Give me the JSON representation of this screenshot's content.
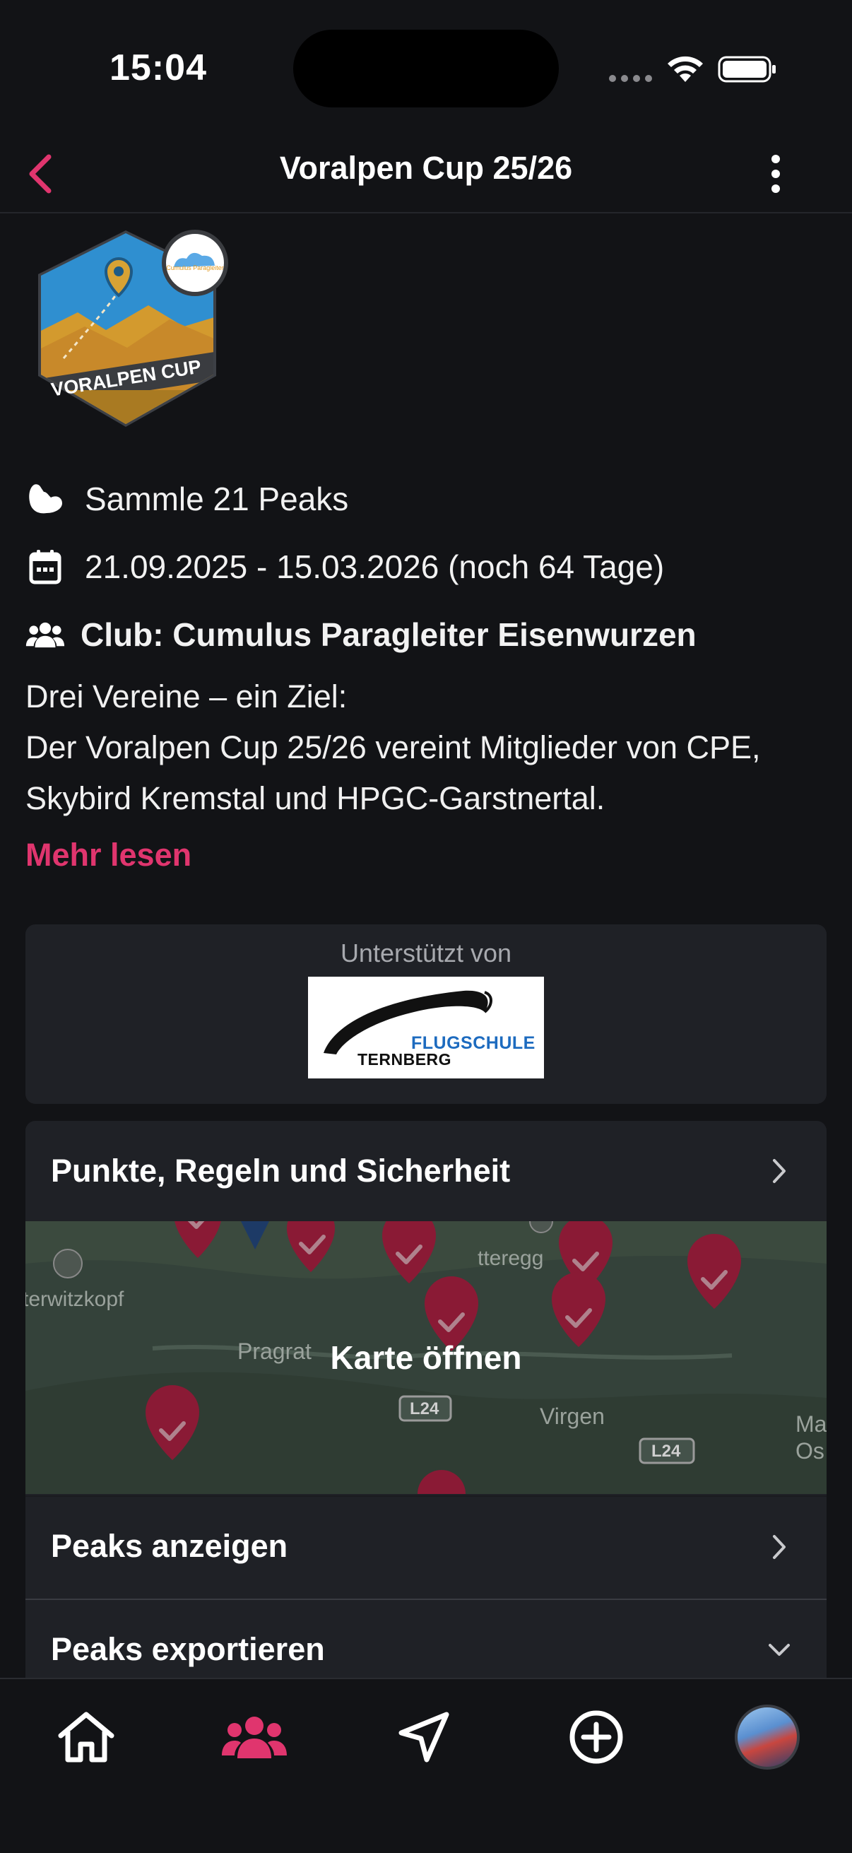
{
  "status_bar": {
    "time": "15:04"
  },
  "nav": {
    "title": "Voralpen Cup 25/26"
  },
  "badge": {
    "name": "VORALPEN CUP",
    "sub_logo": "Cumulus Paragleiter Eisenwurzen"
  },
  "info": {
    "peaks": "Sammle 21 Peaks",
    "dates": "21.09.2025 - 15.03.2026 (noch 64 Tage)",
    "club": "Club: Cumulus Paragleiter Eisenwurzen"
  },
  "description": {
    "line1": "Drei Vereine – ein Ziel:",
    "line2": "Der Voralpen Cup 25/26 vereint Mitglieder von CPE, Skybird Kremstal und HPGC-Garstnertal."
  },
  "read_more": "Mehr lesen",
  "sponsor": {
    "label": "Unterstützt von",
    "logo_line1": "FLUGSCHULE",
    "logo_line2": "TERNBERG"
  },
  "actions": {
    "rules": "Punkte, Regeln und Sicherheit",
    "map": "Karte öffnen",
    "show_peaks": "Peaks anzeigen",
    "export_peaks": "Peaks exportieren"
  },
  "map_labels": {
    "place1": "terwitzkopf",
    "place2": "Pragrat",
    "place3": "Virgen",
    "place4": "tteregg",
    "road1": "L24",
    "road2": "L24",
    "edge": "Ma\nOs"
  },
  "colors": {
    "accent": "#e0356e",
    "background": "#121316",
    "card": "#1f2126"
  },
  "tabs": [
    "home-icon",
    "clubs-icon",
    "navigate-icon",
    "add-icon",
    "profile-avatar"
  ]
}
